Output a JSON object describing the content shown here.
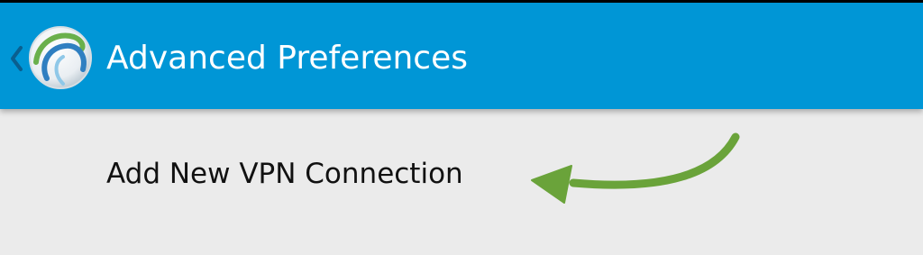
{
  "app_bar": {
    "title": "Advanced Preferences",
    "up_icon": "chevron-left-icon",
    "app_icon": "anyconnect-globe-icon",
    "background_color": "#0096d6",
    "title_color": "#ffffff"
  },
  "list": {
    "items": [
      {
        "label": "Add New VPN Connection"
      }
    ],
    "background_color": "#ebebeb"
  },
  "annotation": {
    "icon": "green-arrow-pointer",
    "color": "#6aa33a"
  }
}
